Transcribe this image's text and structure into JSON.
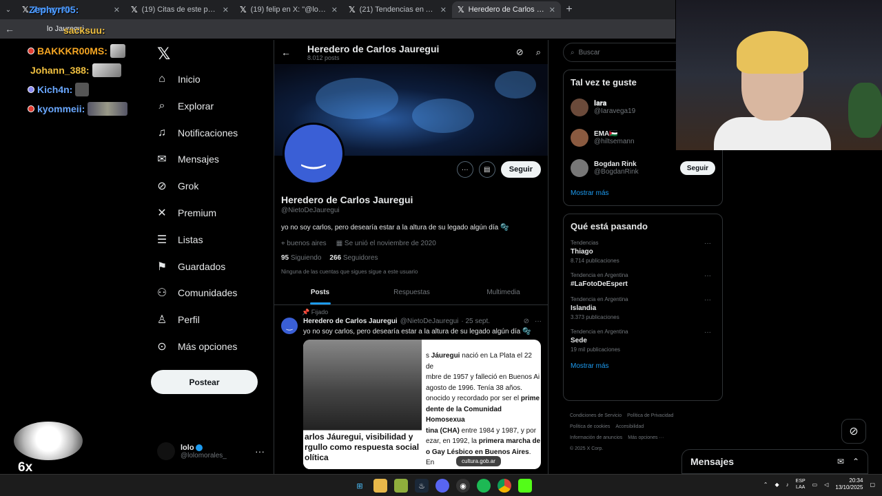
{
  "browser": {
    "tabs": [
      {
        "title": "Zephyrr05:",
        "active": false
      },
      {
        "title": "(19) Citas de este post / X",
        "active": false
      },
      {
        "title": "(19) felip en X: \"@lolomorales_",
        "active": false
      },
      {
        "title": "(21) Tendencias en Argentina e",
        "active": false
      },
      {
        "title": "Heredero de Carlos Jauregui (@",
        "active": true
      }
    ],
    "address": "lo Jauregui"
  },
  "overlay": {
    "top_user": "Zephyrr05:",
    "second_user": "sacksuu:",
    "chat": [
      {
        "user": "BAKKKR00MS:",
        "color": "#f5a623"
      },
      {
        "user": "Johann_388:",
        "color": "#f0c040"
      },
      {
        "user": "Kich4n:",
        "color": "#6aa8ff"
      },
      {
        "user": "kyommeii:",
        "color": "#6aa8ff"
      }
    ],
    "streak": "6x STREAK"
  },
  "nav": {
    "items": [
      {
        "label": "Inicio",
        "icon": "home-icon",
        "glyph": "⌂"
      },
      {
        "label": "Explorar",
        "icon": "search-icon",
        "glyph": "⌕"
      },
      {
        "label": "Notificaciones",
        "icon": "bell-icon",
        "glyph": "♫"
      },
      {
        "label": "Mensajes",
        "icon": "mail-icon",
        "glyph": "✉"
      },
      {
        "label": "Grok",
        "icon": "grok-icon",
        "glyph": "⊘"
      },
      {
        "label": "Premium",
        "icon": "x-premium-icon",
        "glyph": "✕"
      },
      {
        "label": "Listas",
        "icon": "list-icon",
        "glyph": "☰"
      },
      {
        "label": "Guardados",
        "icon": "bookmark-icon",
        "glyph": "⚑"
      },
      {
        "label": "Comunidades",
        "icon": "communities-icon",
        "glyph": "⚇"
      },
      {
        "label": "Perfil",
        "icon": "profile-icon",
        "glyph": "♙"
      },
      {
        "label": "Más opciones",
        "icon": "more-options-icon",
        "glyph": "⊙"
      }
    ],
    "post_button": "Postear",
    "me_name": "lolo",
    "me_handle": "@lolomorales_"
  },
  "profile": {
    "header_title": "Heredero de Carlos Jauregui",
    "post_count": "8.012 posts",
    "name": "Heredero de Carlos Jauregui",
    "handle": "@NietoDeJauregui",
    "bio": "yo no soy carlos, pero desearía estar a la altura de su legado algún día 🫧",
    "location": "buenos aires",
    "joined": "Se unió el noviembre de 2020",
    "following_count": "95",
    "following_label": "Siguiendo",
    "followers_count": "266",
    "followers_label": "Seguidores",
    "note": "Ninguna de las cuentas que sigues sigue a este usuario",
    "follow_button": "Seguir"
  },
  "tabs": [
    {
      "label": "Posts",
      "active": true
    },
    {
      "label": "Respuestas",
      "active": false
    },
    {
      "label": "Multimedia",
      "active": false
    }
  ],
  "pinned_post": {
    "pinned_label": "Fijado",
    "author": "Heredero de Carlos Jauregui",
    "handle": "@NietoDeJauregui",
    "date": "· 25 sept.",
    "text": "yo no soy carlos, pero desearía estar a la altura de su legado algún día 🫧",
    "media_caption": "arlos Jáuregui, visibilidad y rgullo como respuesta social olítica",
    "media_link": "cultura.gob.ar"
  },
  "right": {
    "search_placeholder": "Buscar",
    "who_title": "Tal vez te guste",
    "who": [
      {
        "name": "𝐈𝐚𝐫𝐚",
        "handle": "@Iaravega19",
        "follow": false
      },
      {
        "name": "EMA🇵🇸",
        "handle": "@hiltsemann",
        "follow": false
      },
      {
        "name": "Bogdan Rink",
        "handle": "@BogdanRink",
        "follow": true
      }
    ],
    "follow_label": "Seguir",
    "show_more": "Mostrar más",
    "trends_title": "Qué está pasando",
    "trends": [
      {
        "category": "Tendencias",
        "name": "Thiago",
        "count": "8.714 publicaciones"
      },
      {
        "category": "Tendencia en Argentina",
        "name": "#LaFotoDeEspert",
        "count": ""
      },
      {
        "category": "Tendencia en Argentina",
        "name": "Islandia",
        "count": "3.373 publicaciones"
      },
      {
        "category": "Tendencia en Argentina",
        "name": "Sede",
        "count": "19 mil publicaciones"
      }
    ],
    "trends_more": "Mostrar más",
    "footer": [
      "Condiciones de Servicio",
      "Política de Privacidad",
      "Política de cookies",
      "Accesibilidad",
      "Información de anuncios",
      "Más opciones ···",
      "© 2025 X Corp."
    ]
  },
  "messages": {
    "title": "Mensajes"
  },
  "taskbar": {
    "lang": "ESP",
    "lang2": "LAA",
    "time": "20:34",
    "date": "13/10/2025"
  }
}
